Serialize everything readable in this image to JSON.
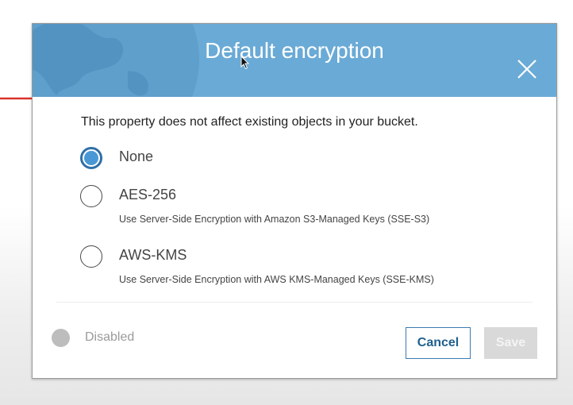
{
  "dialog": {
    "title": "Default encryption",
    "note": "This property does not affect existing objects in your bucket.",
    "options": [
      {
        "label": "None",
        "description": "",
        "selected": true
      },
      {
        "label": "AES-256",
        "description": "Use Server-Side Encryption with Amazon S3-Managed Keys (SSE-S3)",
        "selected": false
      },
      {
        "label": "AWS-KMS",
        "description": "Use Server-Side Encryption with AWS KMS-Managed Keys (SSE-KMS)",
        "selected": false
      }
    ],
    "status_label": "Disabled",
    "cancel_label": "Cancel",
    "save_label": "Save"
  },
  "icons": {
    "close": "close-icon",
    "globe": "globe-icon",
    "pointer": "mouse-cursor-icon",
    "annotation": "red-arrow-icon"
  },
  "colors": {
    "header": "#6aaad6",
    "radio_selected": "#4a97d6",
    "annotation_arrow": "#d9322b",
    "cancel_border": "#3a7ab0",
    "save_disabled": "#d9d9d9"
  }
}
